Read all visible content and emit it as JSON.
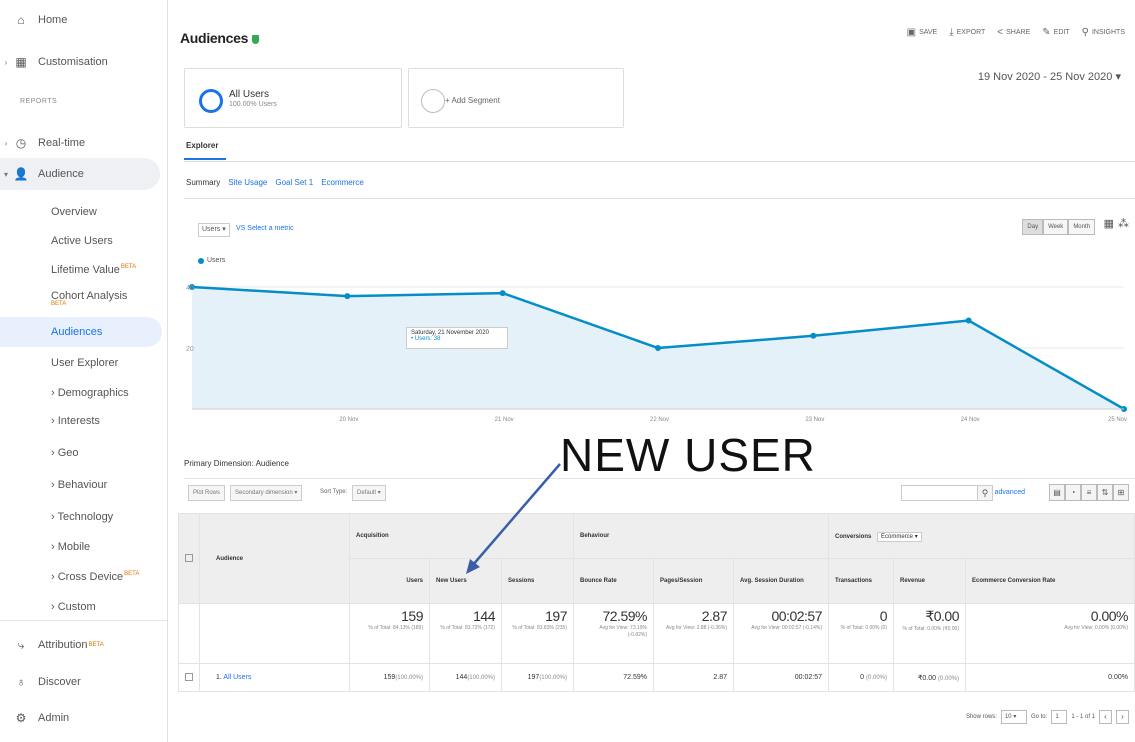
{
  "sidebar": {
    "top": [
      {
        "label": "Home",
        "icon": "home-icon",
        "glyph": "⌂",
        "arrow": ""
      },
      {
        "label": "Customisation",
        "icon": "customisation-icon",
        "glyph": "▦",
        "arrow": "›"
      }
    ],
    "reports_label": "REPORTS",
    "realtime": {
      "label": "Real-time",
      "glyph": "◷",
      "arrow": "›"
    },
    "audience": {
      "label": "Audience",
      "glyph": "👤",
      "arrow": "▾"
    },
    "audience_items": [
      {
        "label": "Overview"
      },
      {
        "label": "Active Users"
      },
      {
        "label": "Lifetime Value",
        "beta": "BETA"
      },
      {
        "label": "Cohort Analysis",
        "beta": "BETA"
      },
      {
        "label": "Audiences"
      },
      {
        "label": "User Explorer"
      },
      {
        "label": "Demographics"
      },
      {
        "label": "Interests"
      },
      {
        "label": "Geo"
      },
      {
        "label": "Behaviour"
      },
      {
        "label": "Technology"
      },
      {
        "label": "Mobile"
      },
      {
        "label": "Cross Device",
        "beta": "BETA"
      },
      {
        "label": "Custom"
      }
    ],
    "bottom": [
      {
        "label": "Attribution",
        "beta": "BETA",
        "glyph": "⤷"
      },
      {
        "label": "Discover",
        "glyph": "♁"
      },
      {
        "label": "Admin",
        "glyph": "⚙"
      }
    ]
  },
  "header": {
    "title": "Audiences",
    "actions": [
      {
        "label": "SAVE",
        "glyph": "▣",
        "icon": "save-icon"
      },
      {
        "label": "EXPORT",
        "glyph": "⤓",
        "icon": "export-icon"
      },
      {
        "label": "SHARE",
        "glyph": "<",
        "icon": "share-icon"
      },
      {
        "label": "EDIT",
        "glyph": "✎",
        "icon": "edit-icon"
      },
      {
        "label": "INSIGHTS",
        "glyph": "⚲",
        "icon": "insights-icon"
      }
    ]
  },
  "segments": {
    "all_users": "All Users",
    "all_users_sub": "100.00% Users",
    "add_segment": "+ Add Segment"
  },
  "date_range": "19 Nov 2020 - 25 Nov 2020",
  "tabs": {
    "explorer": "Explorer",
    "sub": [
      "Summary",
      "Site Usage",
      "Goal Set 1",
      "Ecommerce"
    ]
  },
  "chart_controls": {
    "metric": "Users",
    "vs": "Select a metric",
    "periods": [
      "Day",
      "Week",
      "Month"
    ]
  },
  "chart_data": {
    "type": "area",
    "series": [
      {
        "name": "Users",
        "values": [
          40,
          37,
          38,
          20,
          24,
          29,
          0
        ]
      }
    ],
    "x": [
      "",
      "20 Nov",
      "21 Nov",
      "22 Nov",
      "23 Nov",
      "24 Nov",
      "25 Nov"
    ],
    "y_ticks": [
      "40",
      "20",
      ""
    ],
    "ylim": [
      0,
      40
    ],
    "color": "#058dc7",
    "tooltip": {
      "title": "Saturday, 21 November 2020",
      "value": "• Users: 38"
    }
  },
  "annotation": "NEW USER",
  "table_controls": {
    "primary_dimension_label": "Primary Dimension:",
    "primary_dimension_value": "Audience",
    "plot_rows": "Plot Rows",
    "secondary_dimension": "Secondary dimension ▾",
    "sort_type_label": "Sort Type:",
    "sort_type": "Default ▾",
    "advanced": "advanced"
  },
  "table": {
    "dimension": "Audience",
    "groups": {
      "acquisition": "Acquisition",
      "behaviour": "Behaviour",
      "conversions": "Conversions",
      "conversions_select": "Ecommerce ▾"
    },
    "columns": [
      "Users",
      "New Users",
      "Sessions",
      "Bounce Rate",
      "Pages/Session",
      "Avg. Session Duration",
      "Transactions",
      "Revenue",
      "Ecommerce Conversion Rate"
    ],
    "totals": [
      {
        "value": "159",
        "sub": "% of Total: 84.13% (189)"
      },
      {
        "value": "144",
        "sub": "% of Total: 83.72% (172)"
      },
      {
        "value": "197",
        "sub": "% of Total: 83.83% (235)"
      },
      {
        "value": "72.59%",
        "sub": "Avg for View: 73.19% (-0.82%)"
      },
      {
        "value": "2.87",
        "sub": "Avg for View: 2.88 (-0.36%)"
      },
      {
        "value": "00:02:57",
        "sub": "Avg for View: 00:02:57 (-0.14%)"
      },
      {
        "value": "0",
        "sub": "% of Total: 0.00% (0)"
      },
      {
        "value": "₹0.00",
        "sub": "% of Total: 0.00% (₹0.00)"
      },
      {
        "value": "0.00%",
        "sub": "Avg for View: 0.00% (0.00%)"
      }
    ],
    "row": {
      "index": "1.",
      "name": "All Users",
      "cells": [
        {
          "v": "159",
          "p": "(100.00%)"
        },
        {
          "v": "144",
          "p": "(100.00%)"
        },
        {
          "v": "197",
          "p": "(100.00%)"
        },
        {
          "v": "72.59%",
          "p": ""
        },
        {
          "v": "2.87",
          "p": ""
        },
        {
          "v": "00:02:57",
          "p": ""
        },
        {
          "v": "0",
          "p": "(0.00%)"
        },
        {
          "v": "₹0.00",
          "p": "(0.00%)"
        },
        {
          "v": "0.00%",
          "p": ""
        }
      ]
    }
  },
  "pagination": {
    "show_rows": "Show rows:",
    "rows": "10",
    "goto": "Go to:",
    "page": "1",
    "range": "1 - 1 of 1"
  }
}
